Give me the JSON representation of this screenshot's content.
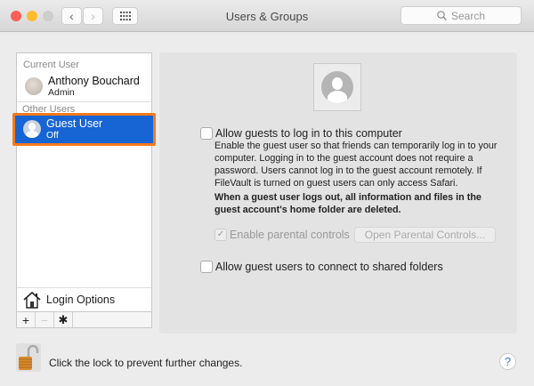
{
  "window": {
    "title": "Users & Groups",
    "search_placeholder": "Search"
  },
  "sidebar": {
    "current_user_header": "Current User",
    "current_user": {
      "name": "Anthony Bouchard",
      "role": "Admin"
    },
    "other_users_header": "Other Users",
    "other_users": [
      {
        "name": "Guest User",
        "status": "Off",
        "selected": true
      }
    ],
    "login_options": "Login Options",
    "toolbar": {
      "add": "+",
      "remove": "−"
    }
  },
  "guest_panel": {
    "allow_login_label": "Allow guests to log in to this computer",
    "allow_login_checked": false,
    "description": "Enable the guest user so that friends can temporarily log in to your computer. Logging in to the guest account does not require a password. Users cannot log in to the guest account remotely. If FileVault is turned on guest users can only access Safari.",
    "warning": "When a guest user logs out, all information and files in the guest account's home folder are deleted.",
    "parental_controls_label": "Enable parental controls",
    "parental_controls_checked": true,
    "open_parental_controls": "Open Parental Controls...",
    "shared_folders_label": "Allow guest users to connect to shared folders",
    "shared_folders_checked": false
  },
  "footer": {
    "lock_text": "Click the lock to prevent further changes.",
    "help": "?"
  },
  "colors": {
    "selection": "#1764d4",
    "highlight": "#f47a1c"
  }
}
